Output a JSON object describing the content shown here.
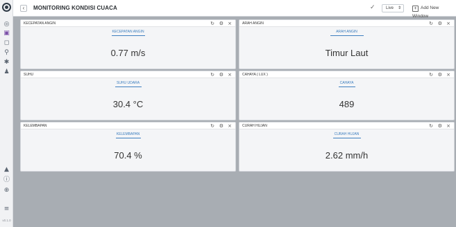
{
  "app": {
    "title": "MONITORING KONDISI CUACA",
    "mode": "Live",
    "add_window_label": "Add New Window",
    "version": "v0.1.0"
  },
  "sidebar": {
    "icons": [
      "dashboard-icon",
      "view-icon",
      "panel-icon",
      "search-icon",
      "settings-icon",
      "users-icon",
      "bell-icon",
      "info-icon",
      "globe-icon",
      "menu-icon"
    ]
  },
  "panels": [
    {
      "name": "KECEPATAN ANGIN",
      "subtitle": "KECEPATAN ANGIN",
      "value": "0.77 m/s"
    },
    {
      "name": "ARAH ANGIN",
      "subtitle": "ARAH ANGIN",
      "value": "Timur Laut"
    },
    {
      "name": "SUHU",
      "subtitle": "SUHU UDARA",
      "value": "30.4 °C"
    },
    {
      "name": "CAHAYA ( lux )",
      "subtitle": "CAHAYA",
      "value": "489"
    },
    {
      "name": "KELEMBAPAN",
      "subtitle": "KELEMBAPAN",
      "value": "70.4 %"
    },
    {
      "name": "CURAH HUJAN",
      "subtitle": "CURAH HUJAN",
      "value": "2.62 mm/h"
    }
  ],
  "panel_controls": {
    "refresh": "↻",
    "settings": "⚙",
    "close": "×"
  }
}
